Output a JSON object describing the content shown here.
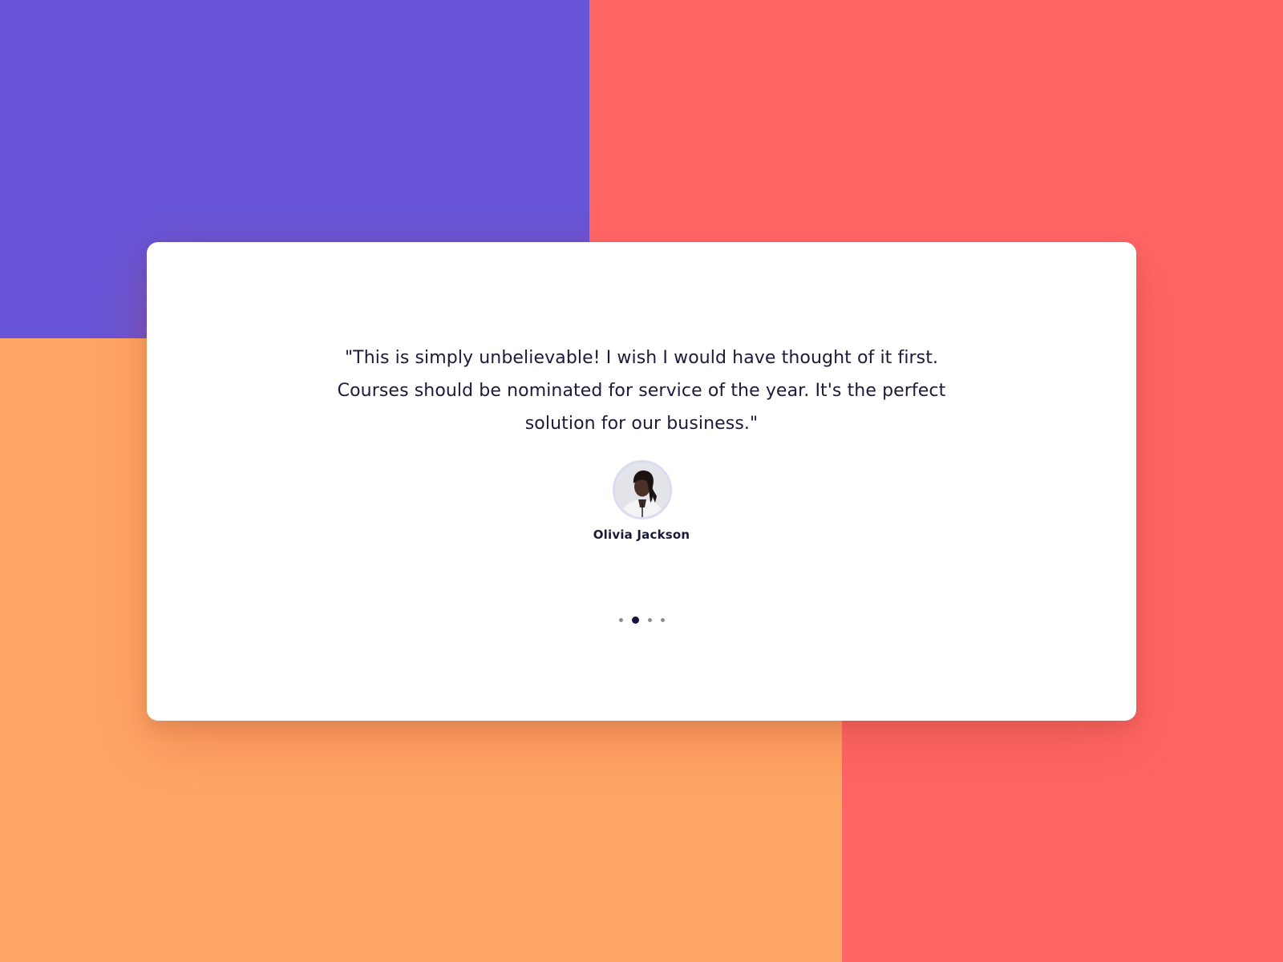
{
  "colors": {
    "purple": "#6854d6",
    "red": "#ff6666",
    "orange": "#ffa766",
    "card": "#ffffff",
    "text": "#1c1a3a",
    "dot_active": "#14123a",
    "dot_inactive": "#8c8c96"
  },
  "testimonial": {
    "quote": "\"This is simply unbelievable! I wish I would have thought of it first. Courses should be nominated for service of the year. It's the perfect solution for our business.\"",
    "author": "Olivia Jackson",
    "avatar_icon": "person-portrait-icon"
  },
  "pagination": {
    "count": 4,
    "active_index": 1
  }
}
